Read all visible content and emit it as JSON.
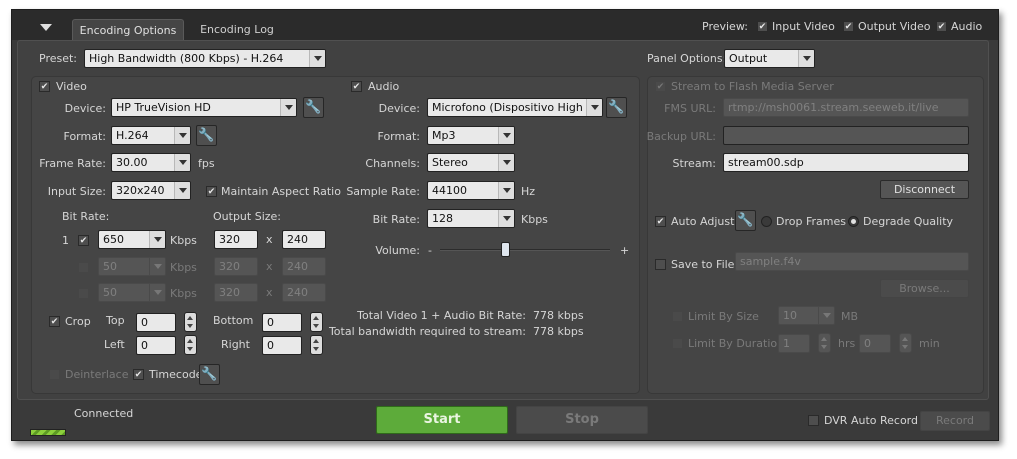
{
  "tabs": {
    "encoding_options": "Encoding Options",
    "encoding_log": "Encoding Log"
  },
  "preview": {
    "label": "Preview:",
    "input_video": "Input Video",
    "output_video": "Output Video",
    "audio": "Audio"
  },
  "preset": {
    "label": "Preset:",
    "value": "High Bandwidth (800 Kbps) - H.264"
  },
  "panel_options": {
    "label": "Panel Options:",
    "value": "Output"
  },
  "video": {
    "title": "Video",
    "device_label": "Device:",
    "device": "HP TrueVision HD",
    "format_label": "Format:",
    "format": "H.264",
    "frame_rate_label": "Frame Rate:",
    "frame_rate": "30.00",
    "fps": "fps",
    "input_size_label": "Input Size:",
    "input_size": "320x240",
    "maintain_aspect": "Maintain Aspect Ratio",
    "bit_rate_label": "Bit Rate:",
    "output_size_label": "Output Size:",
    "rows": [
      {
        "num": "1",
        "rate": "650",
        "unit": "Kbps",
        "w": "320",
        "x": "x",
        "h": "240"
      },
      {
        "num": "",
        "rate": "50",
        "unit": "Kbps",
        "w": "320",
        "x": "x",
        "h": "240"
      },
      {
        "num": "",
        "rate": "50",
        "unit": "Kbps",
        "w": "320",
        "x": "x",
        "h": "240"
      }
    ],
    "crop": "Crop",
    "top_label": "Top",
    "top": "0",
    "bottom_label": "Bottom",
    "bottom": "0",
    "left_label": "Left",
    "left": "0",
    "right_label": "Right",
    "right": "0",
    "deinterlace": "Deinterlace",
    "timecode": "Timecode"
  },
  "audio": {
    "title": "Audio",
    "device_label": "Device:",
    "device": "Microfono (Dispositivo High Def",
    "format_label": "Format:",
    "format": "Mp3",
    "channels_label": "Channels:",
    "channels": "Stereo",
    "sample_rate_label": "Sample Rate:",
    "sample_rate": "44100",
    "hz": "Hz",
    "bit_rate_label": "Bit Rate:",
    "bit_rate": "128",
    "kbps": "Kbps",
    "volume_label": "Volume:",
    "minus": "-",
    "plus": "+",
    "volume_level": 0.38
  },
  "totals": {
    "video_audio_label": "Total Video 1 + Audio Bit Rate:",
    "video_audio": "778 kbps",
    "bandwidth_label": "Total bandwidth required to stream:",
    "bandwidth": "778 kbps"
  },
  "output": {
    "stream_to_fms": "Stream to Flash Media Server",
    "fms_url_label": "FMS URL:",
    "fms_url": "rtmp://msh0061.stream.seeweb.it/live",
    "backup_url_label": "Backup URL:",
    "backup_url": "",
    "stream_label": "Stream:",
    "stream": "stream00.sdp",
    "disconnect": "Disconnect",
    "auto_adjust": "Auto Adjust",
    "drop_frames": "Drop Frames",
    "degrade_quality": "Degrade Quality",
    "save_to_file": "Save to File",
    "file_placeholder": "sample.f4v",
    "browse": "Browse...",
    "limit_by_size": "Limit By Size",
    "size": "10",
    "mb": "MB",
    "limit_by_duration": "Limit By Duration",
    "hrs_value": "1",
    "hrs": "hrs",
    "min_value": "0",
    "min": "min"
  },
  "bottom": {
    "status": "Connected",
    "start": "Start",
    "stop": "Stop",
    "dvr_auto_record": "DVR Auto Record",
    "record": "Record"
  },
  "colors": {
    "start_green": "#5dab3a",
    "window_bg": "#3a3a3a",
    "field_bg": "#e9e9e9"
  }
}
